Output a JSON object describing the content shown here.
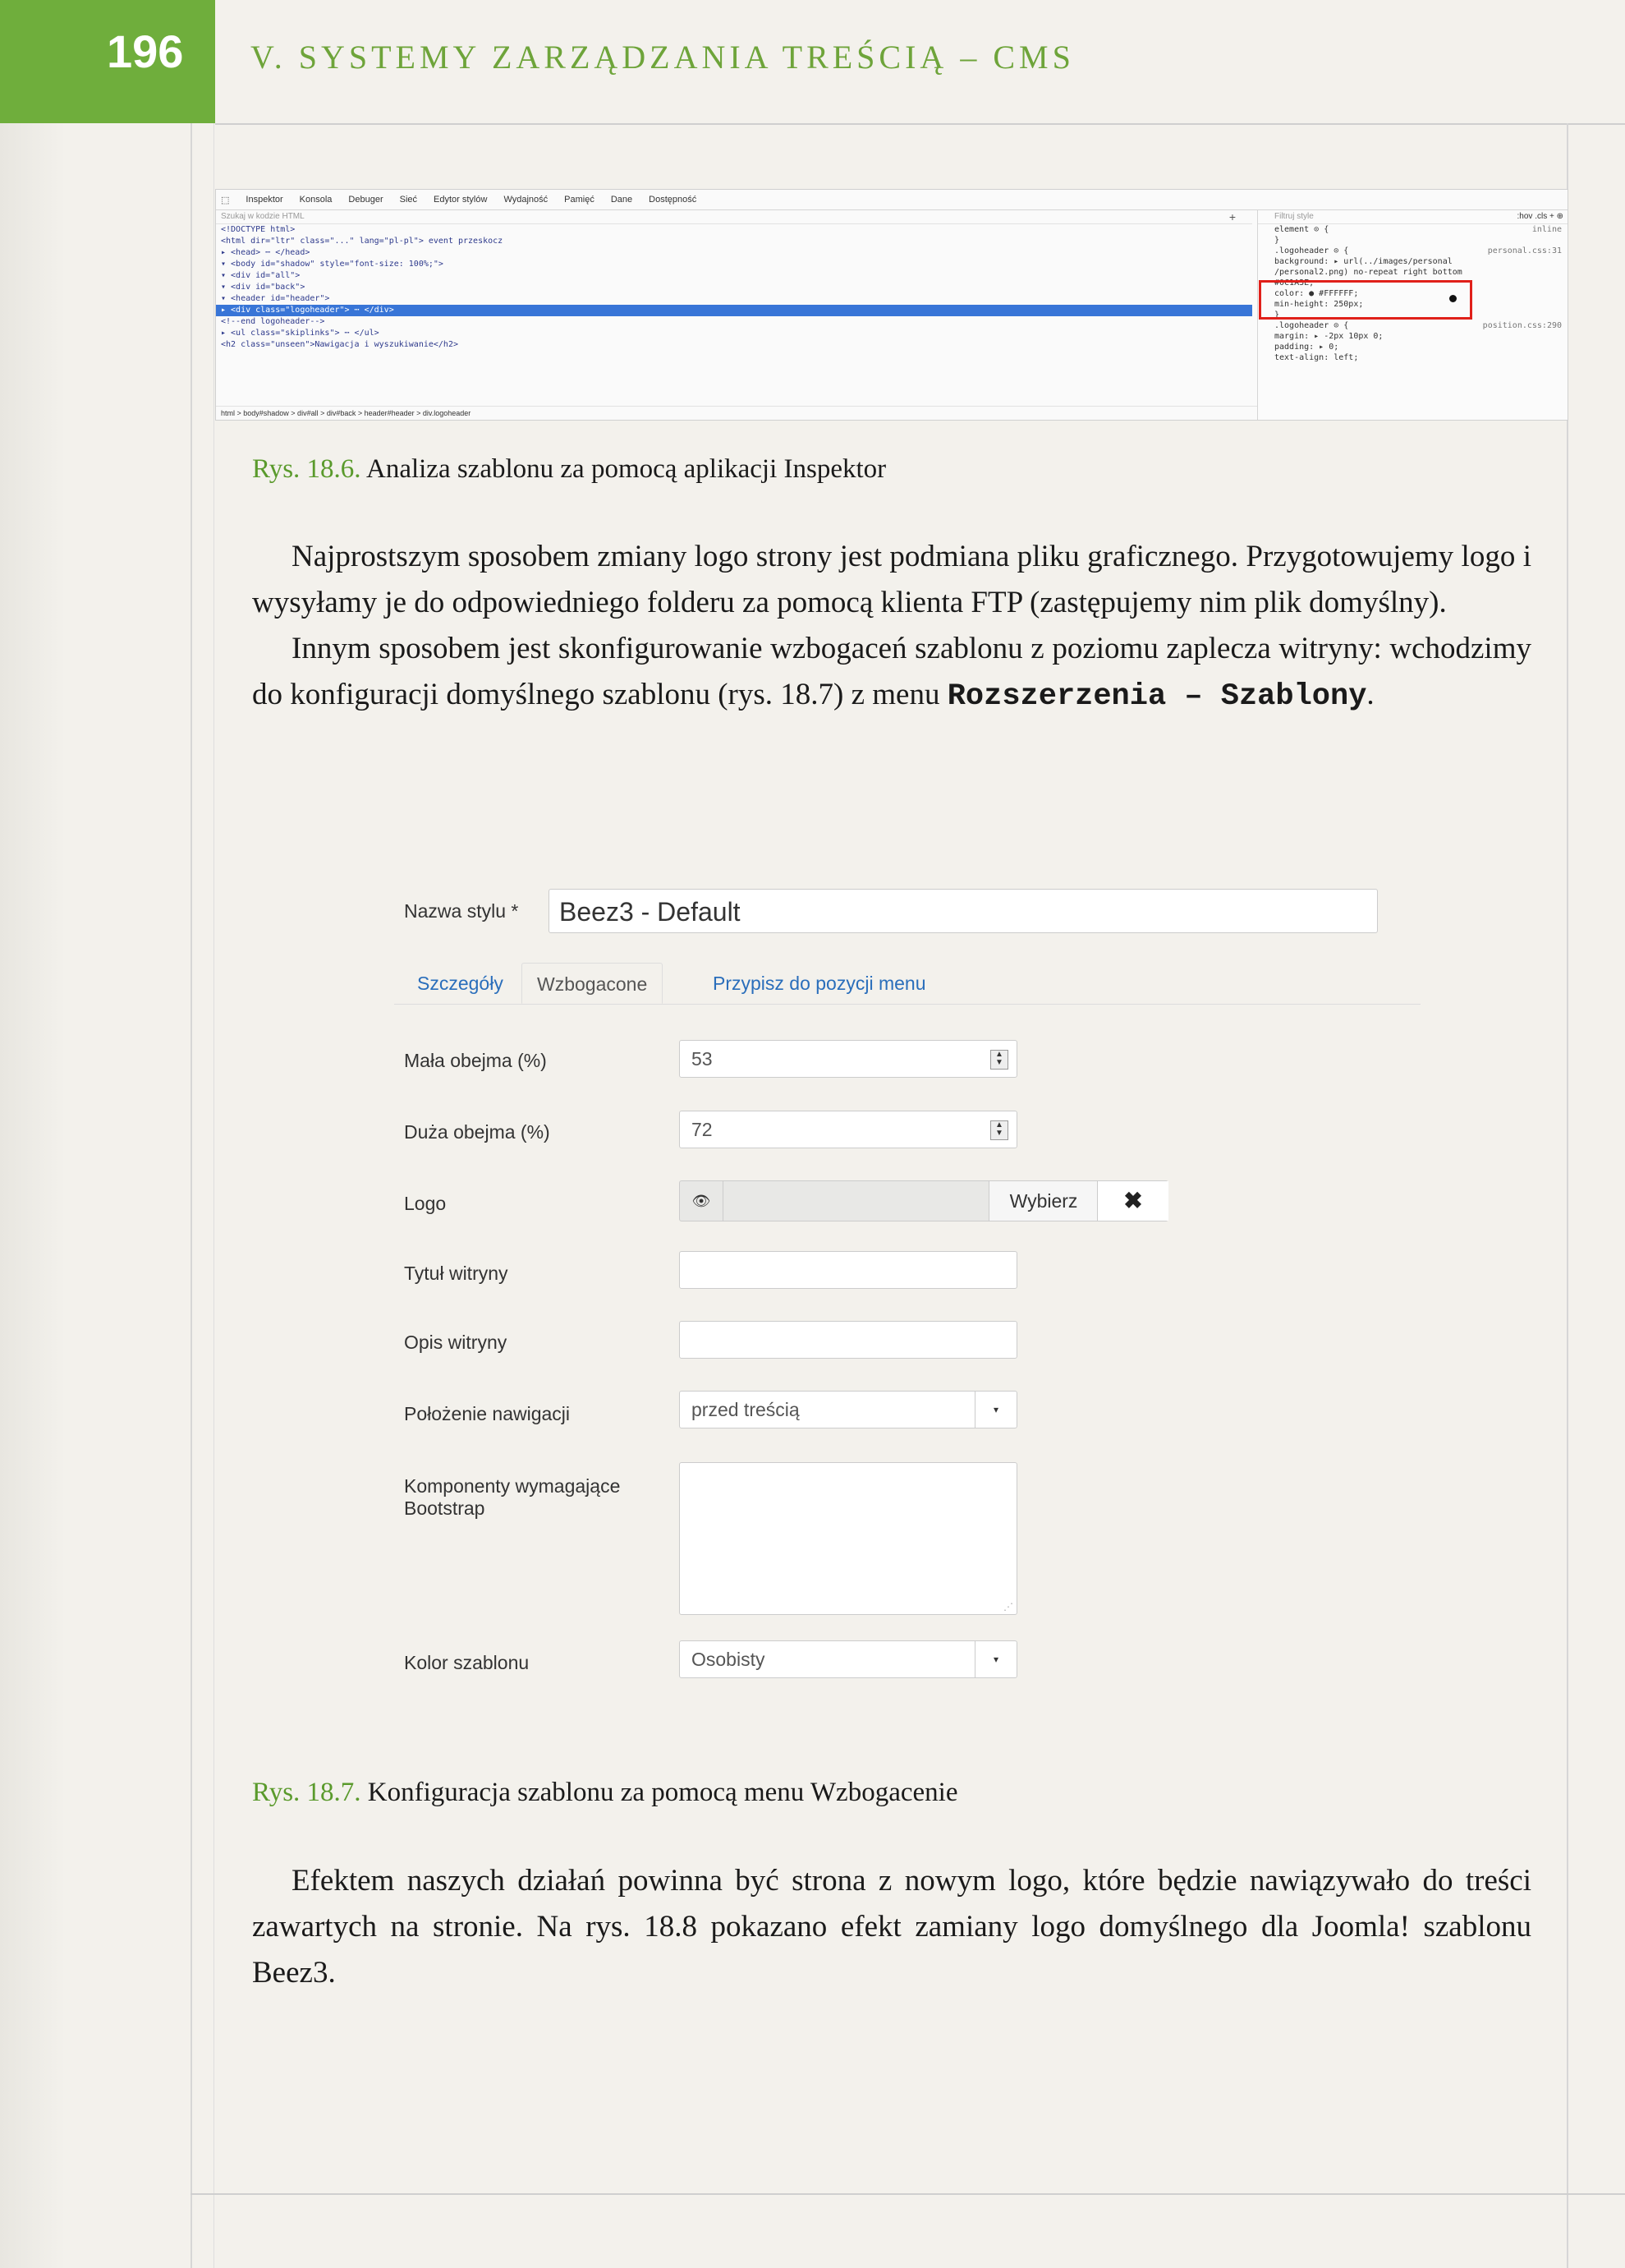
{
  "header": {
    "page_number": "196",
    "running_head": "V. SYSTEMY ZARZĄDZANIA TREŚCIĄ – CMS"
  },
  "inspector": {
    "tabs": [
      "Inspektor",
      "Konsola",
      "Debuger",
      "Sieć",
      "Edytor stylów",
      "Wydajność",
      "Pamięć",
      "Dane",
      "Dostępność"
    ],
    "search_placeholder": "Szukaj w kodzie HTML",
    "tree": [
      "<!DOCTYPE html>",
      "<html dir=\"ltr\" class=\"...\" lang=\"pl-pl\"> event  przeskocz",
      "▸ <head> ⋯ </head>",
      "▾ <body id=\"shadow\" style=\"font-size: 100%;\">",
      "  ▾ <div id=\"all\">",
      "    ▾ <div id=\"back\">",
      "      ▾ <header id=\"header\">",
      "        ▸ <div class=\"logoheader\"> ⋯ </div>",
      "          <!--end logoheader-->",
      "        ▸ <ul class=\"skiplinks\"> ⋯ </ul>",
      "          <h2 class=\"unseen\">Nawigacja i wyszukiwanie</h2>"
    ],
    "crumbs": "html > body#shadow > div#all > div#back > header#header > div.logoheader",
    "filter_placeholder": "Filtruj style",
    "tools": ":hov .cls + ⊕",
    "rules": [
      {
        "text": "element ⊙ {",
        "src": "inline"
      },
      {
        "text": "}",
        "src": ""
      },
      {
        "text": ".logoheader ⊙ {",
        "src": "personal.css:31"
      },
      {
        "text": "  background: ▸ url(../images/personal",
        "src": ""
      },
      {
        "text": "  /personal2.png) no-repeat right bottom",
        "src": ""
      },
      {
        "text": "  #0C1A3E;",
        "src": ""
      },
      {
        "text": "  color: ● #FFFFFF;",
        "src": ""
      },
      {
        "text": "  min-height: 250px;",
        "src": ""
      },
      {
        "text": "}",
        "src": ""
      },
      {
        "text": ".logoheader ⊙ {",
        "src": "position.css:290"
      },
      {
        "text": "  margin: ▸ -2px 10px 0;",
        "src": ""
      },
      {
        "text": "  padding: ▸ 0;",
        "src": ""
      },
      {
        "text": "  text-align: left;",
        "src": ""
      }
    ]
  },
  "caption1": {
    "label": "Rys. 18.6.",
    "text": "Analiza szablonu za pomocą aplikacji Inspektor"
  },
  "para1": "Najprostszym sposobem zmiany logo strony jest podmiana pliku graficznego. Przygotowujemy logo i wysyłamy je do odpowiedniego folderu za pomocą klienta FTP (zastępujemy nim plik domyślny).",
  "para2": {
    "text": "Innym sposobem jest skonfigurowanie wzbogaceń szablonu z poziomu zaplecza witryny: wchodzimy do konfiguracji domyślnego szablonu (rys. 18.7) z menu ",
    "menu": "Rozszerzenia – Szablony",
    "end": "."
  },
  "form": {
    "style_name_label": "Nazwa stylu *",
    "style_name_value": "Beez3 - Default",
    "tabs": [
      "Szczegóły",
      "Wzbogacone",
      "Przypisz do pozycji menu"
    ],
    "fields": {
      "mala_label": "Mała obejma (%)",
      "mala_value": "53",
      "duza_label": "Duża obejma (%)",
      "duza_value": "72",
      "logo_label": "Logo",
      "logo_button": "Wybierz",
      "logo_clear": "✖",
      "tytul_label": "Tytuł witryny",
      "opis_label": "Opis witryny",
      "nav_label": "Położenie nawigacji",
      "nav_value": "przed treścią",
      "bootstrap_label_1": "Komponenty wymagające",
      "bootstrap_label_2": "Bootstrap",
      "kolor_label": "Kolor szablonu",
      "kolor_value": "Osobisty"
    }
  },
  "caption2": {
    "label": "Rys. 18.7.",
    "text": "Konfiguracja szablonu za pomocą menu Wzbogacenie"
  },
  "para3": "Efektem naszych działań powinna być strona z nowym logo, które będzie nawiązywało do treści zawartych na stronie. Na rys. 18.8 pokazano efekt zamiany logo domyślnego dla Joomla! szablonu Beez3.",
  "colors": {
    "accent_green": "#6fae3c",
    "highlight_red": "#e0201a",
    "selection_blue": "#3875d7",
    "link_blue": "#2a6ebb"
  }
}
